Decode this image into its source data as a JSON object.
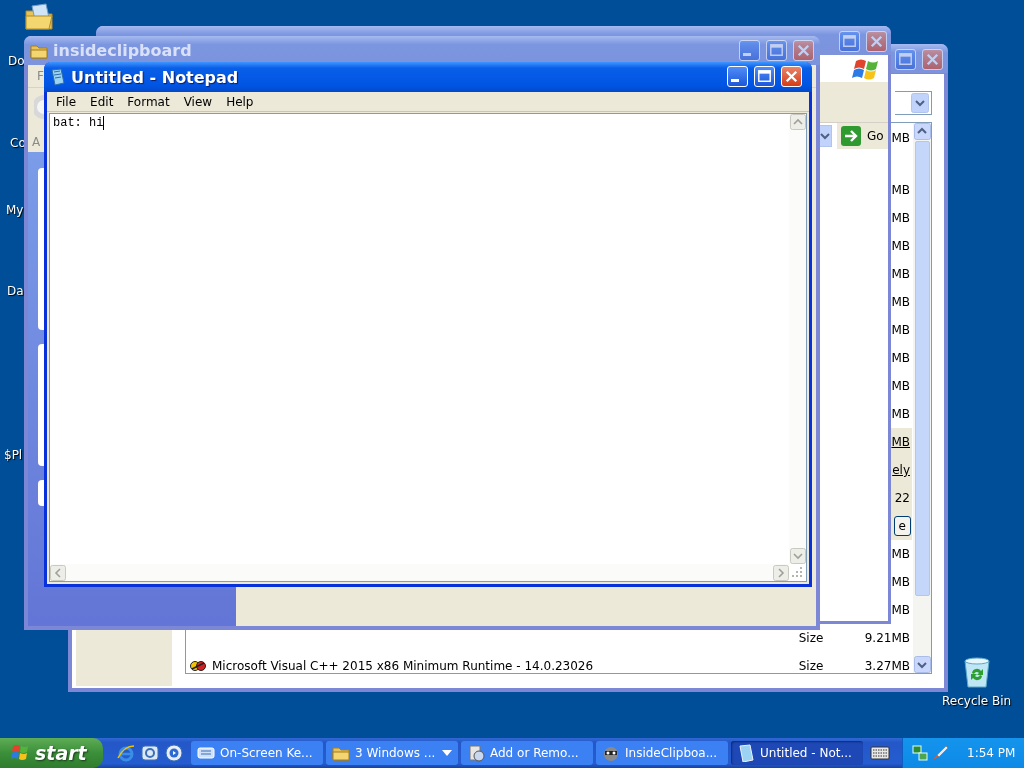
{
  "desktop_icons": [
    {
      "label": "Do",
      "kind": "folder"
    },
    {
      "label": "Co",
      "kind": "hidden"
    },
    {
      "label": "My",
      "kind": "hidden"
    },
    {
      "label": "Da",
      "kind": "hidden"
    },
    {
      "label": "$Pl",
      "kind": "hidden"
    },
    {
      "label": "Recycle Bin",
      "kind": "recycle"
    }
  ],
  "programs_window": {
    "active": false,
    "rows": [
      {
        "kind": "size",
        "text": "MB"
      },
      {
        "kind": "size",
        "text": "MB"
      },
      {
        "kind": "size",
        "text": "MB"
      },
      {
        "kind": "size",
        "text": "MB"
      },
      {
        "kind": "size",
        "text": "MB"
      },
      {
        "kind": "size",
        "text": "MB"
      },
      {
        "kind": "size",
        "text": "MB"
      },
      {
        "kind": "size",
        "text": "MB"
      },
      {
        "kind": "size",
        "text": "MB"
      },
      {
        "kind": "size",
        "text": "MB"
      },
      {
        "kind": "entry",
        "selected": true,
        "lines": [
          {
            "kind": "link",
            "text": "MB"
          },
          {
            "kind": "link",
            "text": "ely"
          },
          {
            "kind": "text",
            "text": "22"
          },
          {
            "kind": "button",
            "text": "e"
          }
        ]
      },
      {
        "kind": "size",
        "text": "MB"
      },
      {
        "kind": "size",
        "text": "MB"
      },
      {
        "kind": "size",
        "text": "MB"
      },
      {
        "kind": "program",
        "label": "Size",
        "value": "9.21MB"
      },
      {
        "kind": "program",
        "name": "Microsoft Visual C++ 2015 x86 Minimum Runtime - 14.0.23026",
        "label": "Size",
        "value": "3.27MB"
      }
    ]
  },
  "explorer_window": {
    "active": false,
    "go_button": "Go"
  },
  "clipboard_window": {
    "active": false,
    "title": "insideclipboard",
    "menu": [
      "F"
    ],
    "address_label": "A"
  },
  "notepad": {
    "active": true,
    "title": "Untitled - Notepad",
    "menu": [
      "File",
      "Edit",
      "Format",
      "View",
      "Help"
    ],
    "text": "bat: hi"
  },
  "taskbar": {
    "start": "start",
    "tasks": [
      {
        "label": "On-Screen Ke...",
        "selected": false,
        "grouped": false
      },
      {
        "label": "3 Windows ...",
        "selected": false,
        "grouped": true
      },
      {
        "label": "Add or Remo...",
        "selected": false,
        "grouped": false
      },
      {
        "label": "InsideClipboa...",
        "selected": false,
        "grouped": false
      },
      {
        "label": "Untitled - Not...",
        "selected": true,
        "grouped": false
      }
    ],
    "clock": "1:54 PM"
  }
}
